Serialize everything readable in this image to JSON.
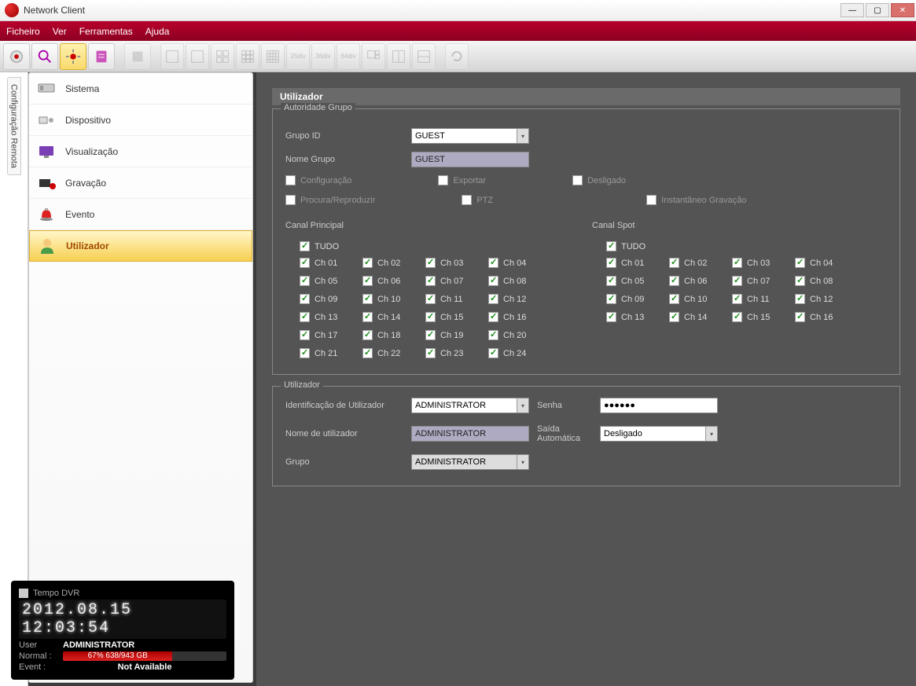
{
  "window": {
    "title": "Network Client"
  },
  "menu": {
    "file": "Ficheiro",
    "view": "Ver",
    "tools": "Ferramentas",
    "help": "Ajuda"
  },
  "sidetab": "Configuração Remota",
  "nav": {
    "items": [
      {
        "label": "Sistema"
      },
      {
        "label": "Dispositivo"
      },
      {
        "label": "Visualização"
      },
      {
        "label": "Gravação"
      },
      {
        "label": "Evento"
      },
      {
        "label": "Utilizador"
      }
    ]
  },
  "page": {
    "title": "Utilizador",
    "group_section": "Autoridade Grupo",
    "group_id_label": "Grupo ID",
    "group_id_value": "GUEST",
    "group_name_label": "Nome Grupo",
    "group_name_value": "GUEST",
    "perm": {
      "config": "Configuração",
      "export": "Exportar",
      "shutdown": "Desligado",
      "search": "Procura/Reproduzir",
      "ptz": "PTZ",
      "snapshot": "Instantâneo Gravação"
    },
    "main_channel": "Canal Principal",
    "spot_channel": "Canal Spot",
    "all": "TUDO",
    "main_channels": [
      "Ch 01",
      "Ch 02",
      "Ch 03",
      "Ch 04",
      "Ch 05",
      "Ch 06",
      "Ch 07",
      "Ch 08",
      "Ch 09",
      "Ch 10",
      "Ch 11",
      "Ch 12",
      "Ch 13",
      "Ch 14",
      "Ch 15",
      "Ch 16",
      "Ch 17",
      "Ch 18",
      "Ch 19",
      "Ch 20",
      "Ch 21",
      "Ch 22",
      "Ch 23",
      "Ch 24"
    ],
    "spot_channels": [
      "Ch 01",
      "Ch 02",
      "Ch 03",
      "Ch 04",
      "Ch 05",
      "Ch 06",
      "Ch 07",
      "Ch 08",
      "Ch 09",
      "Ch 10",
      "Ch 11",
      "Ch 12",
      "Ch 13",
      "Ch 14",
      "Ch 15",
      "Ch 16"
    ],
    "user_section": "Utilizador",
    "user_id_label": "Identificação de Utilizador",
    "user_id_value": "ADMINISTRATOR",
    "user_name_label": "Nome de utilizador",
    "user_name_value": "ADMINISTRATOR",
    "user_group_label": "Grupo",
    "user_group_value": "ADMINISTRATOR",
    "password_label": "Senha",
    "password_value": "●●●●●●",
    "autologout_label": "Saída Automática",
    "autologout_value": "Desligado"
  },
  "clock": {
    "title": "Tempo DVR",
    "datetime": "2012.08.15 12:03:54",
    "user_label": "User",
    "user_value": "ADMINISTRATOR",
    "normal_label": "Normal :",
    "normal_value": "67% 638/943 GB",
    "event_label": "Event   :",
    "event_value": "Not Available"
  }
}
